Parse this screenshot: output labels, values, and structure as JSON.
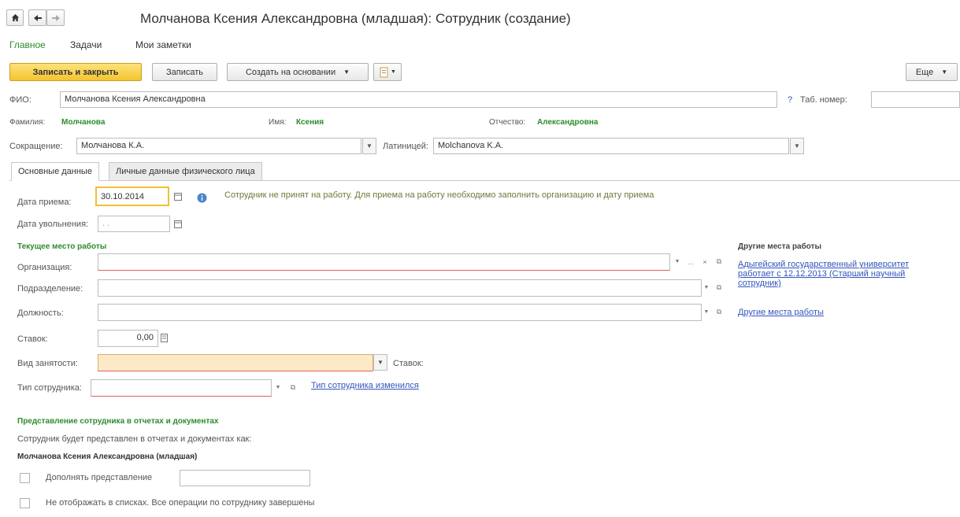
{
  "window": {
    "title": "Молчанова Ксения Александровна (младшая): Сотрудник (создание)"
  },
  "nav": {
    "home_icon": "home-icon",
    "back_icon": "arrow-left-icon",
    "forward_icon": "arrow-right-icon"
  },
  "menu": {
    "items": [
      "Главное",
      "Задачи",
      "Мои заметки"
    ],
    "active": "Главное"
  },
  "toolbar": {
    "save_close": "Записать и закрыть",
    "save": "Записать",
    "create_basis": "Создать на основании",
    "more": "Еще"
  },
  "fio": {
    "label": "ФИО:",
    "value": "Молчанова Ксения Александровна",
    "help": "?",
    "tab_number_label": "Таб. номер:",
    "tab_number_value": ""
  },
  "name_parts": {
    "surname_label": "Фамилия:",
    "surname": "Молчанова",
    "name_label": "Имя:",
    "name": "Ксения",
    "patronymic_label": "Отчество:",
    "patronymic": "Александровна"
  },
  "short": {
    "label": "Сокращение:",
    "value": "Молчанова К.А.",
    "latin_label": "Латиницей:",
    "latin_value": "Molchanova K.A."
  },
  "tabs": [
    "Основные данные",
    "Личные данные физического лица"
  ],
  "hire": {
    "date_label": "Дата приема:",
    "date_value": "30.10.2014",
    "dismiss_label": "Дата увольнения:",
    "dismiss_value": " .  .",
    "info": "Сотрудник не принят на работу. Для приема на работу необходимо заполнить организацию и дату приема"
  },
  "workplace": {
    "section_title": "Текущее место работы",
    "org_label": "Организация:",
    "org_value": "",
    "dept_label": "Подразделение:",
    "dept_value": "",
    "position_label": "Должность:",
    "position_value": "",
    "rate_label": "Ставок:",
    "rate_value": "0,00",
    "employment_label": "Вид занятости:",
    "employment_value": "",
    "employment_rate_label": "Ставок:",
    "type_label": "Тип сотрудника:",
    "type_value": "",
    "type_changed_link": "Тип сотрудника изменился"
  },
  "other": {
    "title": "Другие места работы",
    "item_line1": "Адыгейский государственный университет",
    "item_line2": "работает с 12.12.2013 (Старший научный",
    "item_line3": "сотрудник)",
    "link": "Другие места работы"
  },
  "representation": {
    "section_title": "Представление сотрудника в отчетах и документах",
    "caption": "Сотрудник будет представлен в отчетах и документах как:",
    "value": "Молчанова Ксения Александровна (младшая)",
    "supplement_label": "Дополнять представление",
    "supplement_value": "",
    "hide_label": "Не отображать в списках. Все операции по сотруднику завершены"
  },
  "colors": {
    "accent_green": "#2e8b2e",
    "primary_button": "#f4c430",
    "link": "#3355bb",
    "required_field": "#fde9c6"
  }
}
